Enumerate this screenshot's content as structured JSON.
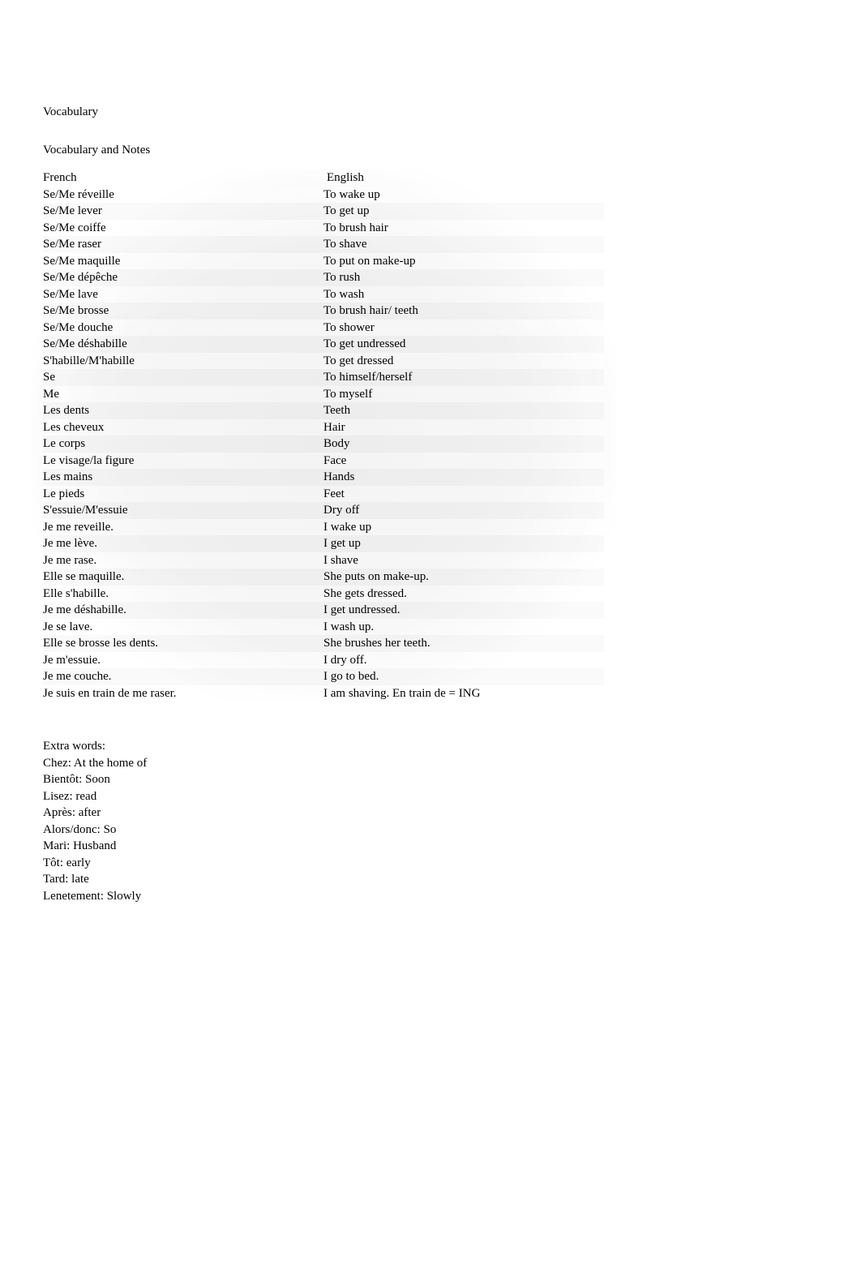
{
  "title": "Vocabulary",
  "subtitle": "Vocabulary and Notes",
  "table": {
    "headers": {
      "french": "French",
      "english": " English"
    },
    "rows": [
      {
        "french": "Se/Me réveille",
        "english": "To wake up"
      },
      {
        "french": "Se/Me lever",
        "english": "To get up"
      },
      {
        "french": "Se/Me coiffe",
        "english": "To brush hair"
      },
      {
        "french": "Se/Me raser",
        "english": "To shave"
      },
      {
        "french": "Se/Me maquille",
        "english": "To put on make-up"
      },
      {
        "french": "Se/Me dépêche",
        "english": "To rush"
      },
      {
        "french": "Se/Me lave",
        "english": "To wash"
      },
      {
        "french": "Se/Me brosse",
        "english": "To brush hair/ teeth"
      },
      {
        "french": "Se/Me douche",
        "english": "To shower"
      },
      {
        "french": "Se/Me déshabille",
        "english": "To get undressed"
      },
      {
        "french": "S'habille/M'habille",
        "english": "To get dressed"
      },
      {
        "french": "Se",
        "english": "To himself/herself"
      },
      {
        "french": "Me",
        "english": "To myself"
      },
      {
        "french": "Les dents",
        "english": "Teeth"
      },
      {
        "french": "Les cheveux",
        "english": "Hair"
      },
      {
        "french": "Le corps",
        "english": "Body"
      },
      {
        "french": "Le visage/la figure",
        "english": "Face"
      },
      {
        "french": "Les mains",
        "english": "Hands"
      },
      {
        "french": "Le pieds",
        "english": "Feet"
      },
      {
        "french": "S'essuie/M'essuie",
        "english": "Dry off"
      },
      {
        "french": "Je me reveille.",
        "english": "I wake up"
      },
      {
        "french": "Je me lève.",
        "english": "I get up"
      },
      {
        "french": "Je me rase.",
        "english": "I shave"
      },
      {
        "french": "Elle se maquille.",
        "english": "She puts on make-up."
      },
      {
        "french": "Elle s'habille.",
        "english": "She gets dressed."
      },
      {
        "french": "Je me déshabille.",
        "english": "I get undressed."
      },
      {
        "french": "Je se lave.",
        "english": "I wash up."
      },
      {
        "french": "Elle se brosse les dents.",
        "english": "She brushes her teeth."
      },
      {
        "french": "Je m'essuie.",
        "english": "I dry off."
      },
      {
        "french": "Je me couche.",
        "english": "I go to bed."
      },
      {
        "french": "Je suis en train de me raser.",
        "english": "I am shaving. En train de = ING"
      }
    ]
  },
  "extra": {
    "title": "Extra words:",
    "lines": [
      "Chez: At the home of",
      "Bientôt: Soon",
      "Lisez: read",
      "Après: after",
      "Alors/donc: So",
      "Mari: Husband",
      "Tôt: early",
      "Tard: late",
      "Lenetement: Slowly"
    ]
  }
}
